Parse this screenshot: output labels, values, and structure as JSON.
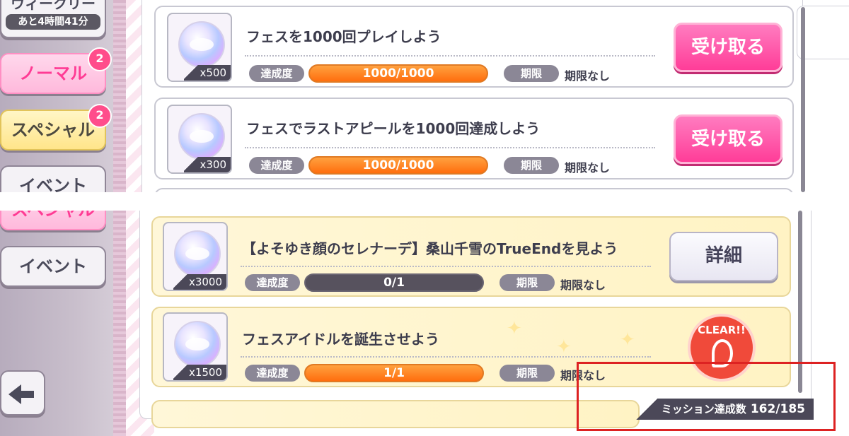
{
  "top_view": {
    "sidebar": {
      "weekly": {
        "label": "ウィークリー",
        "time": "あと4時間41分"
      },
      "normal": {
        "label": "ノーマル",
        "badge": "2"
      },
      "special": {
        "label": "スペシャル",
        "badge": "2"
      },
      "event": {
        "label": "イベント"
      }
    },
    "missions": [
      {
        "title": "フェスを1000回プレイしよう",
        "quantity": "x500",
        "progress_label": "達成度",
        "progress": "1000/1000",
        "progress_fraction": 1.0,
        "deadline_label": "期限",
        "deadline": "期限なし",
        "action": "受け取る"
      },
      {
        "title": "フェスでラストアピールを1000回達成しよう",
        "quantity": "x300",
        "progress_label": "達成度",
        "progress": "1000/1000",
        "progress_fraction": 1.0,
        "deadline_label": "期限",
        "deadline": "期限なし",
        "action": "受け取る"
      }
    ]
  },
  "bottom_view": {
    "sidebar": {
      "special": {
        "label": "スペシャル"
      },
      "event": {
        "label": "イベント"
      }
    },
    "missions": [
      {
        "title": "【よそゆき顔のセレナーデ】桑山千雪のTrueEndを見よう",
        "quantity": "x3000",
        "progress_label": "達成度",
        "progress": "0/1",
        "progress_fraction": 0.0,
        "deadline_label": "期限",
        "deadline": "期限なし",
        "action": "詳細"
      },
      {
        "title": "フェスアイドルを誕生させよう",
        "quantity": "x1500",
        "progress_label": "達成度",
        "progress": "1/1",
        "progress_fraction": 1.0,
        "deadline_label": "期限",
        "deadline": "期限なし",
        "stamp": "CLEAR!!"
      }
    ],
    "footer": {
      "label": "ミッション達成数",
      "count": "162/185"
    }
  },
  "colors": {
    "accent_pink": "#ff3d98",
    "progress_orange": "#ff6e0e",
    "highlight_red": "#dd2222",
    "clear_red": "#f04a3a"
  }
}
